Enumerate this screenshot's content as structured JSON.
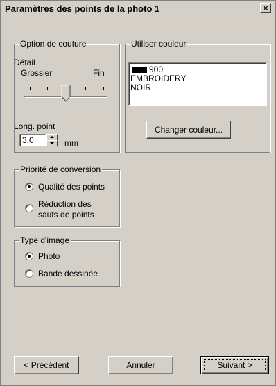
{
  "window": {
    "title": "Paramètres des points de la photo 1",
    "close_glyph": "✕"
  },
  "stitch_options": {
    "legend": "Option de couture",
    "detail_label": "Détail",
    "coarse_label": "Grossier",
    "fine_label": "Fin",
    "detail_level": 0.5,
    "stitch_length_label": "Long. point",
    "stitch_length_value": "3.0",
    "unit": "mm"
  },
  "color": {
    "legend": "Utiliser couleur",
    "swatch_color": "#000000",
    "code": "900",
    "brand": "EMBROIDERY",
    "name": "NOIR",
    "change_button": "Changer couleur..."
  },
  "conversion_priority": {
    "legend": "Priorité de conversion",
    "options": [
      {
        "label": "Qualité des points",
        "selected": true
      },
      {
        "label_line1": "Réduction des",
        "label_line2": "sauts de points",
        "selected": false
      }
    ]
  },
  "image_type": {
    "legend": "Type d'image",
    "options": [
      {
        "label": "Photo",
        "selected": true
      },
      {
        "label": "Bande dessinée",
        "selected": false
      }
    ]
  },
  "footer": {
    "previous": "< Précédent",
    "cancel": "Annuler",
    "next": "Suivant >"
  }
}
